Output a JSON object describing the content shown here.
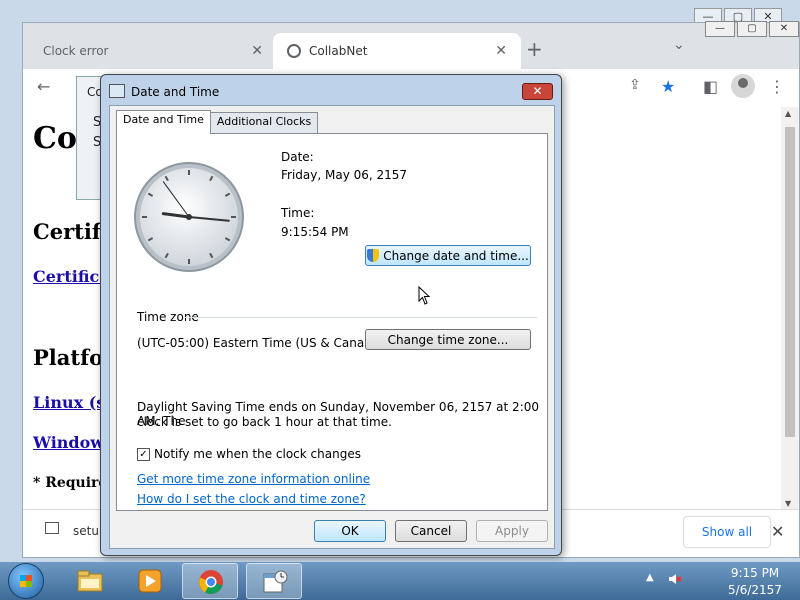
{
  "browser": {
    "tabs": [
      {
        "label": "Clock error"
      },
      {
        "label": "CollabNet"
      }
    ],
    "page": {
      "title": "Col",
      "headings": [
        "Certifi",
        "Platfor"
      ],
      "links": [
        "Certifica",
        "Linux (s",
        "Window"
      ],
      "required_note": "* Require"
    },
    "download": {
      "file": "setup",
      "show_all": "Show all"
    }
  },
  "background_dialog": {
    "title": "Co",
    "line1": "S",
    "line2": "S"
  },
  "dialog": {
    "title": "Date and Time",
    "tabs": [
      "Date and Time",
      "Additional Clocks"
    ],
    "date_label": "Date:",
    "date_value": "Friday, May 06, 2157",
    "time_label": "Time:",
    "time_value": "9:15:54 PM",
    "change_datetime_button": "Change date and time...",
    "timezone_section": "Time zone",
    "timezone_value": "(UTC-05:00) Eastern Time (US & Canada)",
    "change_timezone_button": "Change time zone...",
    "dst_line1": "Daylight Saving Time ends on Sunday, November 06, 2157 at 2:00 AM. The",
    "dst_line2": "clock is set to go back 1 hour at that time.",
    "notify_label": "Notify me when the clock changes",
    "notify_checked": true,
    "link_more_info": "Get more time zone information online",
    "link_how_to": "How do I set the clock and time zone?",
    "ok_button": "OK",
    "cancel_button": "Cancel",
    "apply_button": "Apply",
    "clock_hands": {
      "hour": 9,
      "minute": 15,
      "second": 54
    }
  },
  "taskbar": {
    "time": "9:15 PM",
    "date": "5/6/2157",
    "apps": [
      "file-explorer-icon",
      "media-player-icon",
      "chrome-icon",
      "date-time-icon"
    ]
  }
}
